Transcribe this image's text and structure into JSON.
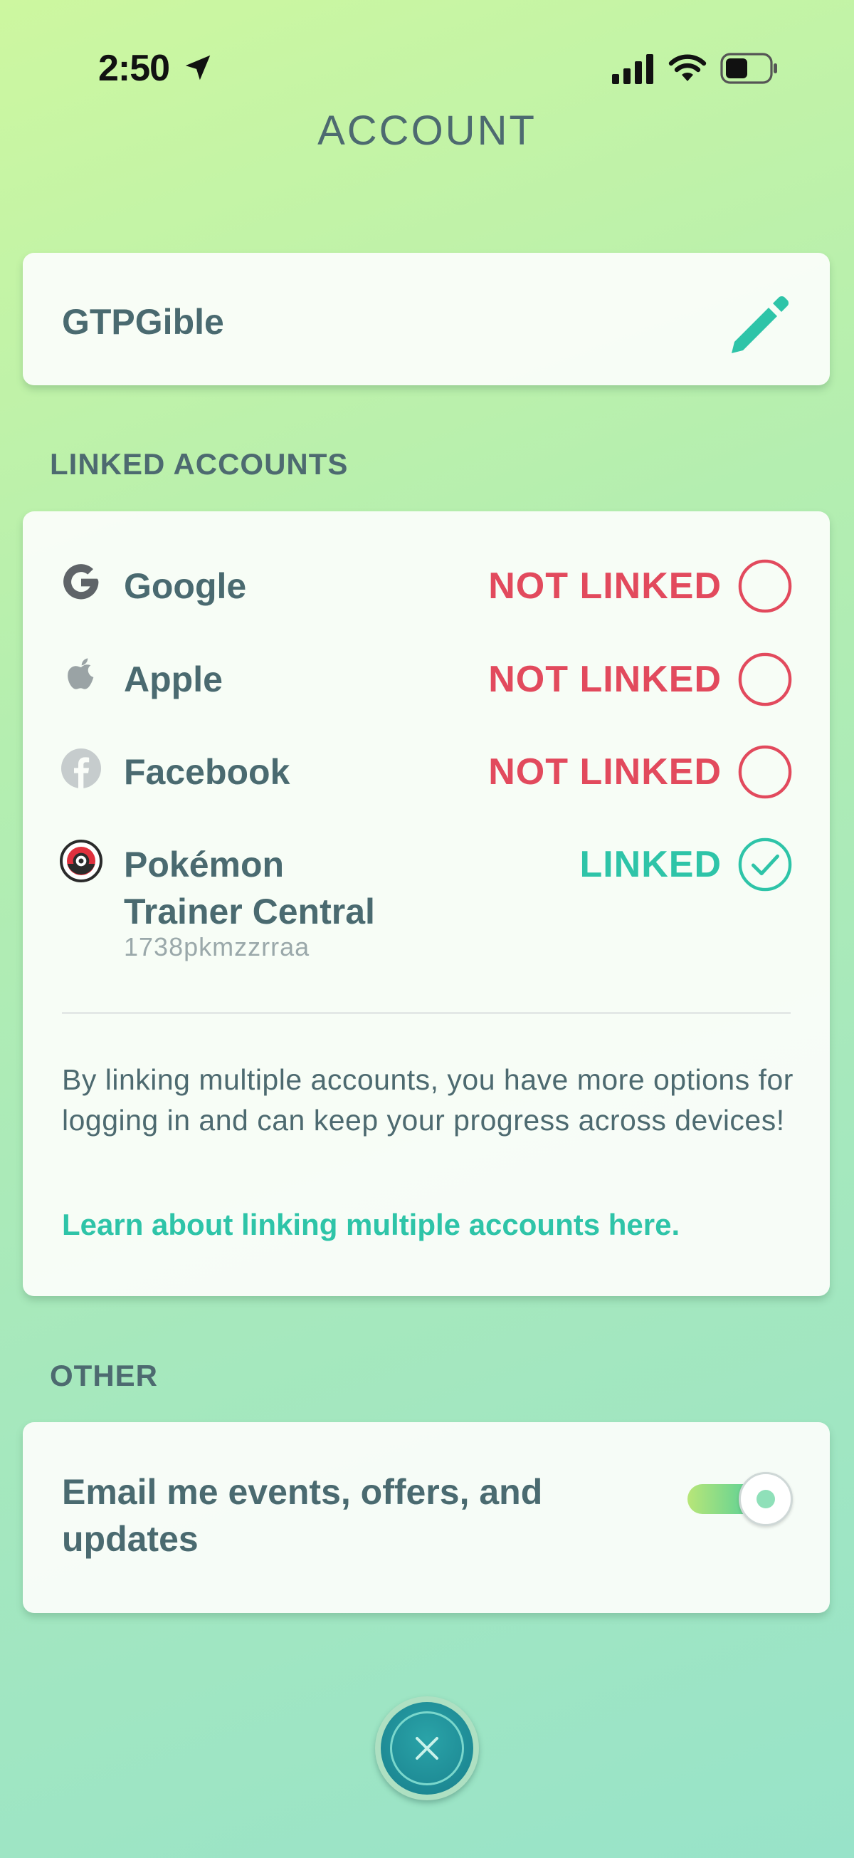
{
  "status_bar": {
    "time": "2:50",
    "icons": [
      "location-arrow-icon",
      "cellular-signal-icon",
      "wifi-icon",
      "battery-icon"
    ]
  },
  "page": {
    "title": "ACCOUNT"
  },
  "profile": {
    "username": "GTPGible",
    "edit_icon": "pencil-edit-icon"
  },
  "linked_accounts": {
    "section_label": "LINKED ACCOUNTS",
    "items": [
      {
        "name": "Google",
        "status": "NOT LINKED",
        "linked": false,
        "icon": "google-icon"
      },
      {
        "name": "Apple",
        "status": "NOT LINKED",
        "linked": false,
        "icon": "apple-icon"
      },
      {
        "name": "Facebook",
        "status": "NOT LINKED",
        "linked": false,
        "icon": "facebook-icon"
      },
      {
        "name_line1": "Pokémon",
        "name_line2": "Trainer Central",
        "status": "LINKED",
        "linked": true,
        "account_id": "1738pkmzzrraa",
        "icon": "pokemon-trainer-club-icon"
      }
    ],
    "info_text": "By linking multiple accounts, you have more options for logging in and can keep your progress across devices!",
    "learn_link": "Learn about linking multiple accounts here."
  },
  "other": {
    "section_label": "OTHER",
    "email_line1": "Email me events, offers, and",
    "email_line2": "updates",
    "email_opt_in": true
  },
  "colors": {
    "not_linked": "#e24a5d",
    "linked": "#2ec4a8",
    "text": "#4a6a70",
    "close_button": "#187f8c"
  }
}
